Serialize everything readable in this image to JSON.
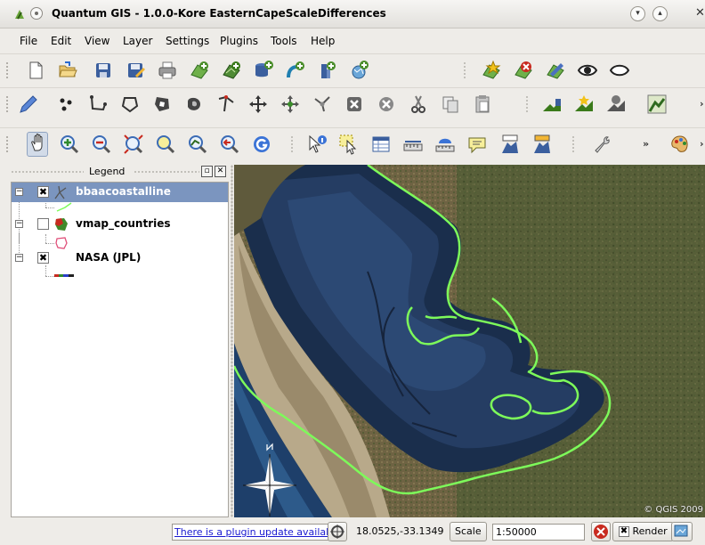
{
  "window": {
    "title": "Quantum GIS - 1.0.0-Kore  EasternCapeScaleDifferences",
    "minimize_glyph": "▾",
    "maximize_glyph": "▴",
    "close_glyph": "✕"
  },
  "menu": [
    "File",
    "Edit",
    "View",
    "Layer",
    "Settings",
    "Plugins",
    "Tools",
    "Help"
  ],
  "toolbar_overflow": "»",
  "legend": {
    "title": "Legend",
    "float_glyph": "▫",
    "close_glyph": "✕",
    "layers": [
      {
        "name": "bbaacoastalline",
        "checked": true,
        "selected": true,
        "expander": "−",
        "check_glyph": "✖"
      },
      {
        "name": "vmap_countries",
        "checked": false,
        "selected": false,
        "expander": "−",
        "check_glyph": ""
      },
      {
        "name": "NASA (JPL)",
        "checked": true,
        "selected": false,
        "expander": "−",
        "check_glyph": "✖"
      }
    ]
  },
  "map": {
    "copyright": "© QGIS 2009",
    "coastline_color": "#7dfa5a"
  },
  "status": {
    "plugin_update": "There is a plugin update available",
    "coordinates": "18.0525,-33.1349",
    "scale_label": "Scale",
    "scale_value": "1:50000",
    "render_label": "Render",
    "render_checked": true
  },
  "colors": {
    "legend_selection": "#7b95bf",
    "link": "#1a1ad0"
  }
}
